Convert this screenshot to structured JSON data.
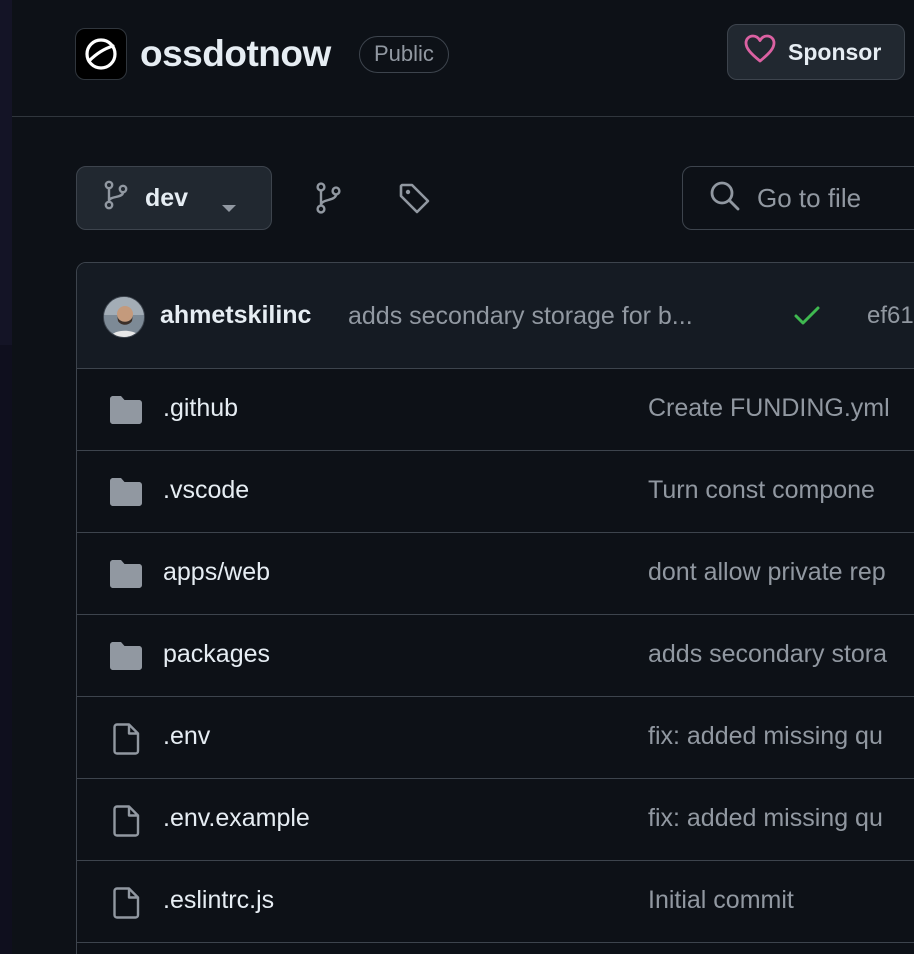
{
  "repo": {
    "name": "ossdotnow",
    "visibility": "Public",
    "sponsor_label": "Sponsor"
  },
  "toolbar": {
    "branch": "dev",
    "goto_placeholder": "Go to file"
  },
  "latest_commit": {
    "author": "ahmetskilinc",
    "message": "adds secondary storage for b...",
    "status": "success",
    "sha": "ef61"
  },
  "files": [
    {
      "name": ".github",
      "type": "folder",
      "commit": "Create FUNDING.yml"
    },
    {
      "name": ".vscode",
      "type": "folder",
      "commit": "Turn const compone"
    },
    {
      "name": "apps/web",
      "type": "folder",
      "commit": "dont allow private rep"
    },
    {
      "name": "packages",
      "type": "folder",
      "commit": "adds secondary stora"
    },
    {
      "name": ".env",
      "type": "file",
      "commit": "fix: added missing qu"
    },
    {
      "name": ".env.example",
      "type": "file",
      "commit": "fix: added missing qu"
    },
    {
      "name": ".eslintrc.js",
      "type": "file",
      "commit": "Initial commit"
    }
  ],
  "colors": {
    "background": "#0d1117",
    "border": "#3d444d",
    "muted_text": "#9198a1",
    "sponsor_heart": "#db61a2",
    "success": "#3fb950",
    "folder_icon": "#9198a1"
  }
}
